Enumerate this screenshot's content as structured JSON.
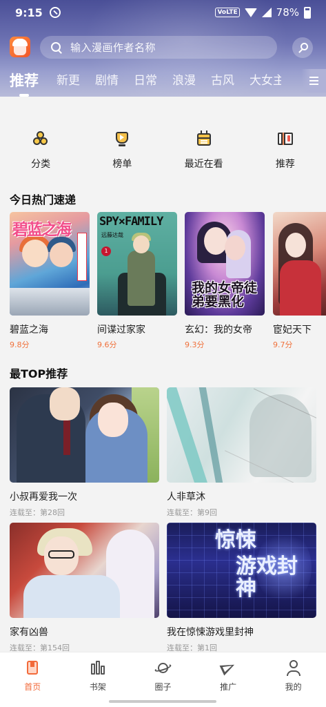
{
  "status_bar": {
    "time": "9:15",
    "network_badge": "VoLTE",
    "battery": "78%"
  },
  "header": {
    "search_placeholder": "输入漫画作者名称",
    "tabs": [
      {
        "label": "推荐",
        "active": true
      },
      {
        "label": "新更"
      },
      {
        "label": "剧情"
      },
      {
        "label": "日常"
      },
      {
        "label": "浪漫"
      },
      {
        "label": "古风"
      },
      {
        "label": "大女主"
      }
    ],
    "accent_gradient": [
      "#4a4f97",
      "#b8bbd9"
    ]
  },
  "quick_actions": [
    {
      "label": "分类",
      "icon": "category-icon"
    },
    {
      "label": "榜单",
      "icon": "ranking-icon"
    },
    {
      "label": "最近在看",
      "icon": "recent-icon"
    },
    {
      "label": "推荐",
      "icon": "recommend-icon"
    }
  ],
  "hot_today": {
    "title": "今日热门速递",
    "items": [
      {
        "title": "碧蓝之海",
        "score": "9.8分",
        "cover_text": "碧蓝之海"
      },
      {
        "title": "间谍过家家",
        "score": "9.6分",
        "cover_text": "SPY×FAMILY",
        "cover_sub": "远藤达哉",
        "cover_badge": "1"
      },
      {
        "title": "玄幻：我的女帝",
        "score": "9.3分",
        "cover_text": "我的女帝徒弟要黑化"
      },
      {
        "title": "宦妃天下",
        "score": "9.7分"
      }
    ]
  },
  "top_recommend": {
    "title": "最TOP推荐",
    "items": [
      {
        "title": "小叔再爱我一次",
        "progress": "连载至：第28回"
      },
      {
        "title": "人非草沐",
        "progress": "连载至：第9回"
      },
      {
        "title": "家有凶兽",
        "progress": "连载至：第154回"
      },
      {
        "title": "我在惊悚游戏里封神",
        "progress": "连载至：第1回",
        "cover_text": [
          "惊悚",
          "游戏封神"
        ]
      }
    ]
  },
  "bottom_nav": [
    {
      "label": "首页",
      "icon": "home-icon",
      "active": true
    },
    {
      "label": "书架",
      "icon": "bookshelf-icon"
    },
    {
      "label": "圈子",
      "icon": "planet-icon"
    },
    {
      "label": "推广",
      "icon": "paper-plane-icon"
    },
    {
      "label": "我的",
      "icon": "profile-icon"
    }
  ],
  "colors": {
    "accent": "#f26a3a",
    "score": "#f0713b",
    "background": "#f3f3f3"
  }
}
